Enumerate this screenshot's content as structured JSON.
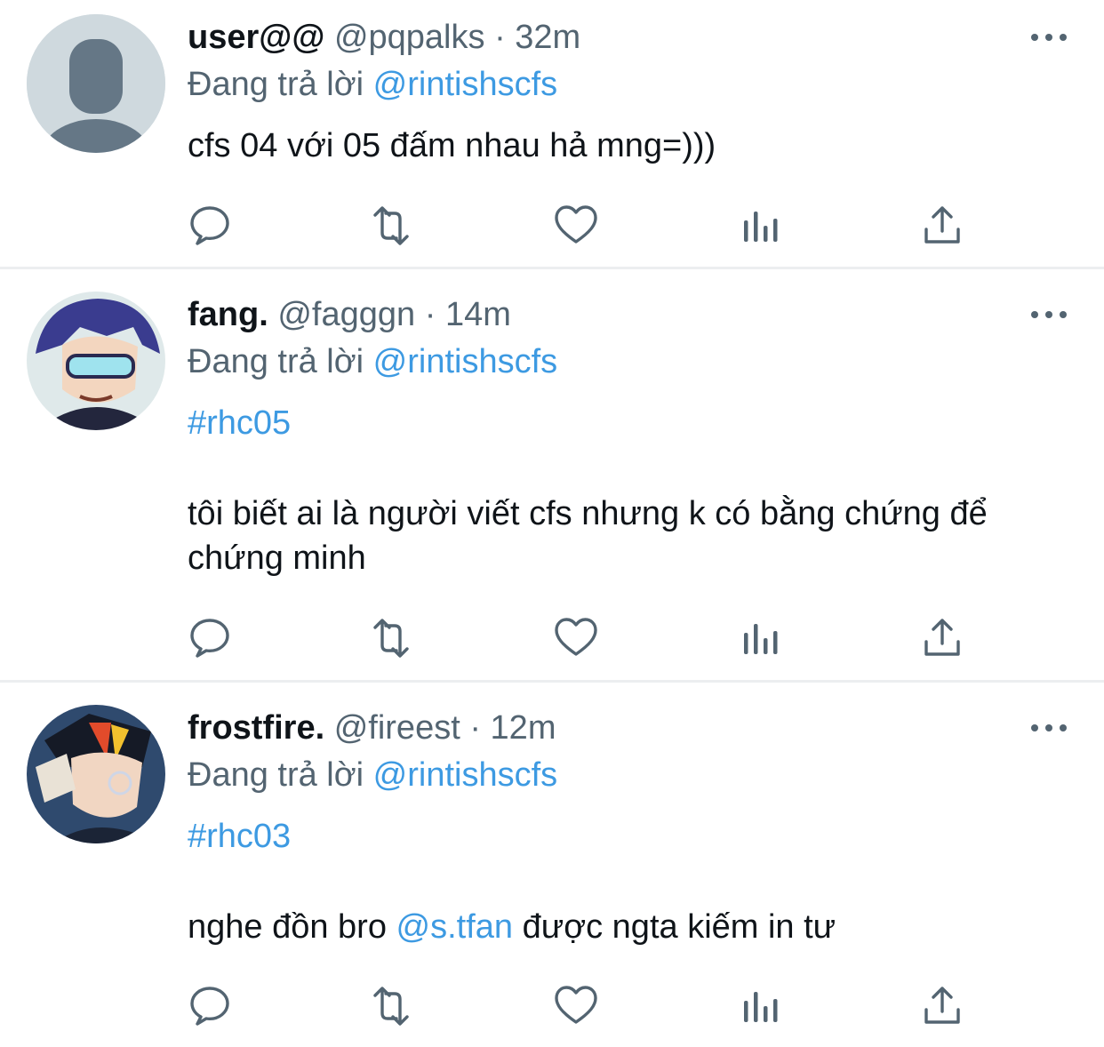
{
  "tweets": [
    {
      "name": "user@@",
      "handle": "@pqpalks",
      "sep": "·",
      "time": "32m",
      "reply_prefix": "Đang trả lời",
      "reply_to": "@rintishscfs",
      "hashtag": "",
      "text": "cfs 04 với 05 đấm nhau hả mng=)))",
      "avatar": "default-avatar-icon"
    },
    {
      "name": "fang.",
      "handle": "@fagggn",
      "sep": "·",
      "time": "14m",
      "reply_prefix": "Đang trả lời",
      "reply_to": "@rintishscfs",
      "hashtag": "#rhc05",
      "text": "tôi biết ai là người viết cfs nhưng k có bằng chứng để chứng minh",
      "avatar": "anime-avatar-blue-hair"
    },
    {
      "name": "frostfire.",
      "handle": "@fireest",
      "sep": "·",
      "time": "12m",
      "reply_prefix": "Đang trả lời",
      "reply_to": "@rintishscfs",
      "hashtag": "#rhc03",
      "text_before": "nghe đồn bro",
      "mention": "@s.tfan",
      "text_after": "được ngta kiếm in tư",
      "avatar": "anime-avatar-dark-hair"
    }
  ],
  "icons": {
    "reply": "reply-icon",
    "retweet": "retweet-icon",
    "like": "like-icon",
    "views": "views-icon",
    "share": "share-icon",
    "more": "more-icon"
  },
  "colors": {
    "link": "#3d9ae2",
    "muted": "#536471",
    "text": "#0f1419",
    "divider": "#eceef0"
  }
}
